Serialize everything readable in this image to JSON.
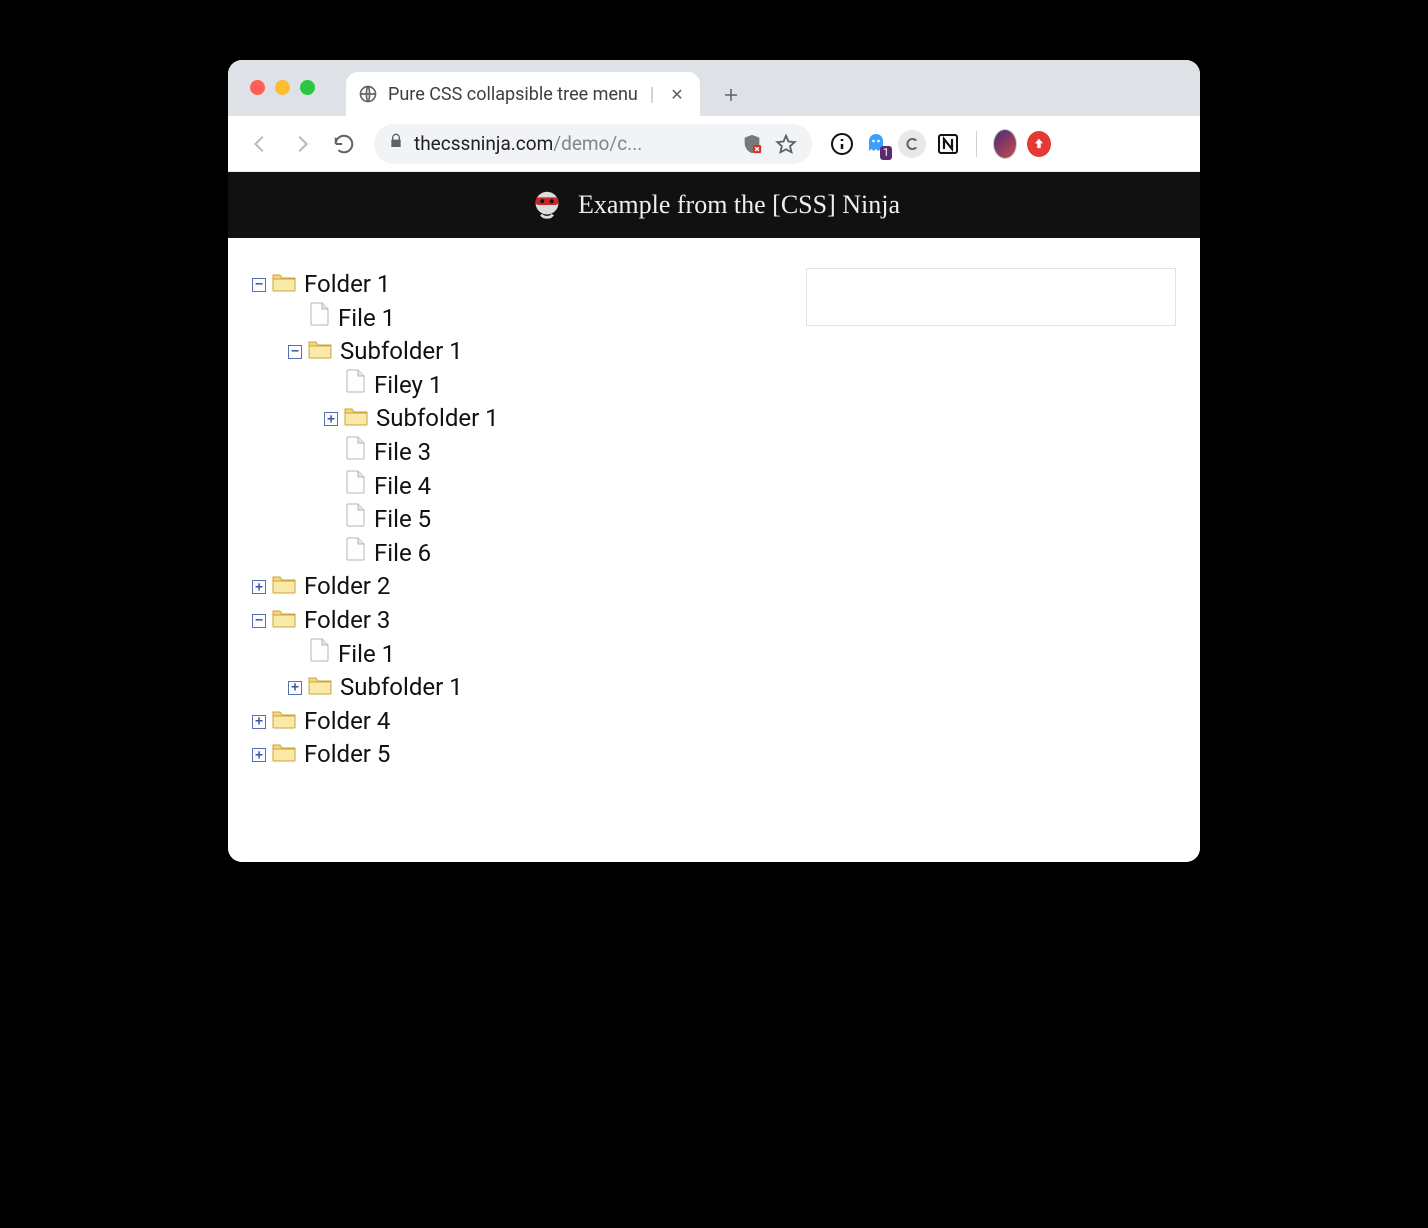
{
  "browser": {
    "tab_title": "Pure CSS collapsible tree menu",
    "url_host": "thecssninja.com",
    "url_path": "/demo/c...",
    "ghost_badge": "1"
  },
  "page": {
    "banner_text": "Example from the [CSS] Ninja",
    "tree": [
      {
        "label": "Folder 1",
        "type": "folder",
        "state": "open",
        "children": [
          {
            "label": "File 1",
            "type": "file"
          },
          {
            "label": "Subfolder 1",
            "type": "folder",
            "state": "open",
            "children": [
              {
                "label": "Filey 1",
                "type": "file"
              },
              {
                "label": "Subfolder 1",
                "type": "folder",
                "state": "closed"
              },
              {
                "label": "File 3",
                "type": "file"
              },
              {
                "label": "File 4",
                "type": "file"
              },
              {
                "label": "File 5",
                "type": "file"
              },
              {
                "label": "File 6",
                "type": "file"
              }
            ]
          }
        ]
      },
      {
        "label": "Folder 2",
        "type": "folder",
        "state": "closed"
      },
      {
        "label": "Folder 3",
        "type": "folder",
        "state": "open",
        "children": [
          {
            "label": "File 1",
            "type": "file"
          },
          {
            "label": "Subfolder 1",
            "type": "folder",
            "state": "closed"
          }
        ]
      },
      {
        "label": "Folder 4",
        "type": "folder",
        "state": "closed"
      },
      {
        "label": "Folder 5",
        "type": "folder",
        "state": "closed"
      }
    ]
  }
}
